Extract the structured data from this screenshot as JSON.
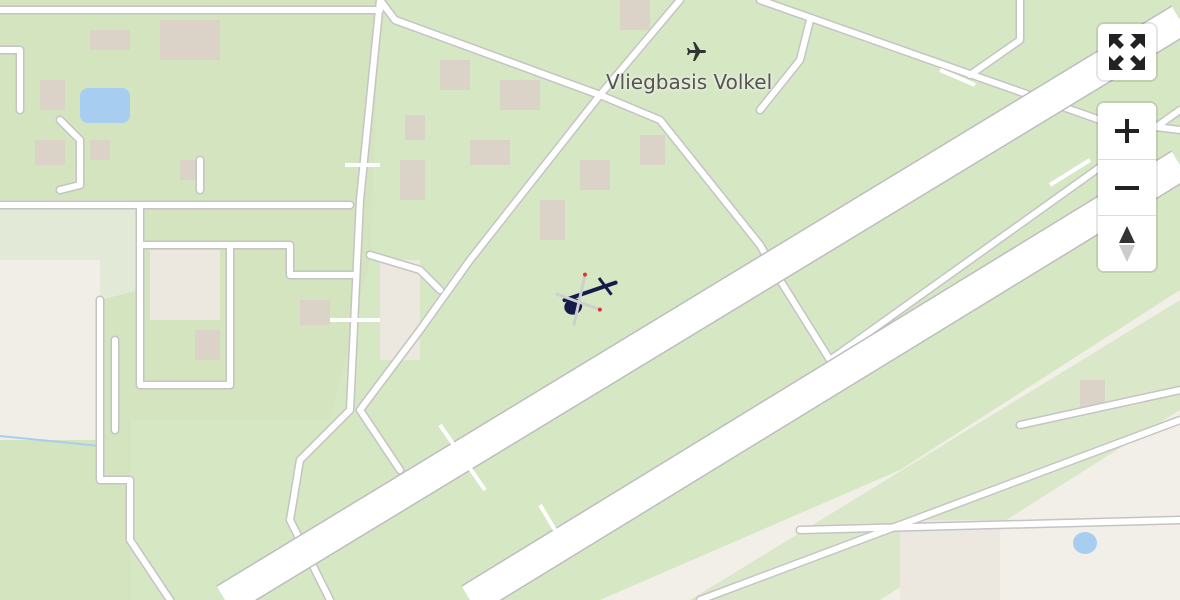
{
  "map": {
    "place_label": "Vliegbasis Volkel",
    "place_icon": "airport-icon",
    "colors": {
      "grass": "#d5e6c2",
      "urban": "#f2efe9",
      "farmland": "#f4f1ea",
      "road": "#ffffff",
      "road_casing": "#c8c8c8",
      "runway": "#ffffff",
      "water": "#a7cdf0"
    }
  },
  "controls": {
    "fullscreen_icon": "fullscreen-icon",
    "zoom_in_icon": "zoom-in-icon",
    "zoom_out_icon": "zoom-out-icon",
    "compass_icon": "compass-icon"
  },
  "markers": [
    {
      "name": "helicopter-marker",
      "icon": "helicopter-icon"
    }
  ]
}
